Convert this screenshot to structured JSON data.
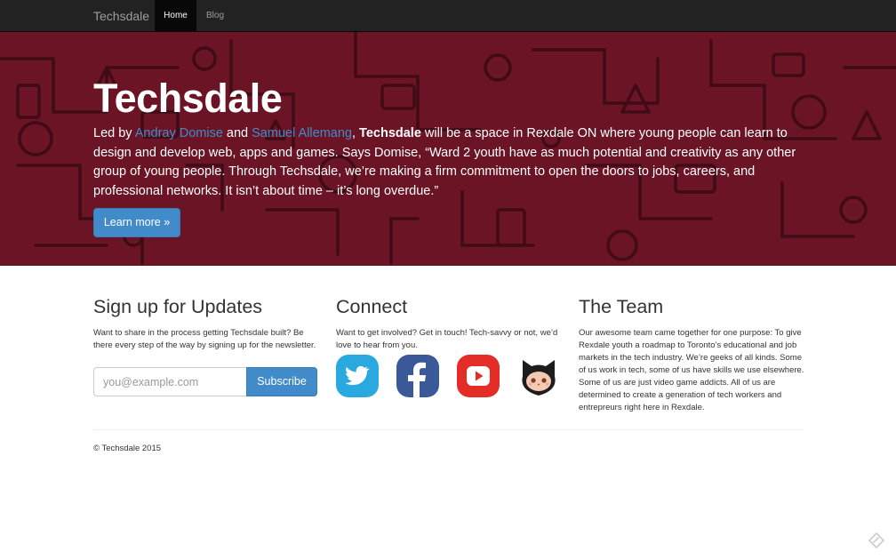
{
  "navbar": {
    "brand": "Techsdale",
    "links": [
      {
        "label": "Home",
        "active": true
      },
      {
        "label": "Blog",
        "active": false
      }
    ]
  },
  "hero": {
    "title": "Techsdale",
    "paragraph": {
      "t1": "Led by ",
      "link1": "Andray Domise",
      "t2": " and ",
      "link2": "Samuel Allemang",
      "t3": ", ",
      "bold": "Techsdale",
      "t4": " will be a space in Rexdale ON where young people can learn to design and develop web, apps and games. Says Domise, “Ward 2 youth have as much potential and creativity as any other group of young people. Through Techsdale, we’re making a firm commitment to open the doors to jobs, careers, and professional networks. It isn’t about time – it’s long overdue.”"
    },
    "button_label": "Learn more »"
  },
  "signup": {
    "heading": "Sign up for Updates",
    "text": "Want to share in the process getting Techsdale built? Be there every step of the way by signing up for the newsletter.",
    "email_placeholder": "you@example.com",
    "email_value": "",
    "button_label": "Subscribe"
  },
  "connect": {
    "heading": "Connect",
    "text": "Want to get involved? Get in touch! Tech-savvy or not, we’d love to hear from you.",
    "icons": [
      "twitter-icon",
      "facebook-icon",
      "youtube-icon",
      "github-icon"
    ]
  },
  "team": {
    "heading": "The Team",
    "text": "Our awesome team came together for one purpose: To give Rexdale youth a roadmap to Toronto’s educational and job markets in the tech industry. We’re geeks of all kinds. Some of us work in tech, some of us have skills we use elsewhere. Some of us are just video game addicts. All of us are determined to create a generation of tech workers and entrepreurs right here in Rexdale."
  },
  "footer": {
    "copyright": "© Techsdale 2015"
  },
  "colors": {
    "navbar_bg": "#222222",
    "hero_bg": "#6a1425",
    "accent": "#428bca",
    "twitter": "#2aa9e0",
    "facebook": "#3b5998",
    "youtube": "#e52d27"
  }
}
